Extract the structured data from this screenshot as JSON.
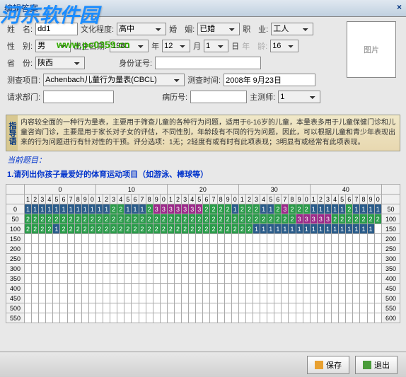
{
  "watermark": "河东软件园",
  "url": "www.pc0359.cn",
  "window": {
    "title": "编辑答案",
    "close": "×"
  },
  "form": {
    "name_lbl": "姓　名:",
    "name": "dd1",
    "edu_lbl": "文化程度:",
    "edu": "高中",
    "marry_lbl": "婚　姻:",
    "marry": "已婚",
    "job_lbl": "职　业:",
    "job": "工人",
    "sex_lbl": "性　别:",
    "sex": "男",
    "birth_lbl": "出生日期:",
    "birth_y": "1980",
    "y": "年",
    "birth_m": "12",
    "m": "月",
    "birth_d": "1",
    "d": "日",
    "age_lbl": "年　龄:",
    "age": "16",
    "prov_lbl": "省　份:",
    "prov": "陕西",
    "id_lbl": "身份证号:",
    "proj_lbl": "测查项目:",
    "proj": "Achenbach儿童行为量表(CBCL)",
    "time_lbl": "测查时间:",
    "time": "2008年 9月23日",
    "dept_lbl": "请求部门:",
    "case_lbl": "病历号:",
    "doc_lbl": "主测师:",
    "doc": "1",
    "imgbox": "图片"
  },
  "guide": {
    "tab": "指导语",
    "text": "内容较全面的一种行为量表，主要用于筛查儿童的各种行为问题，适用于6-16岁的儿童，本量表多用于儿童保健门诊和儿童咨询门诊，主要是用于家长对子女的评估，不同性别，年龄段有不同的行为问题，因此，可以根据儿童和青少年表现出来的行为问题进行有针对性的干预。评分选项：1无；2轻度有或有时有此项表现；3明显有或经常有此项表现。"
  },
  "current": "当前题目：",
  "question": "1.请列出你孩子最爱好的体育运动项目（如游泳、棒球等）",
  "grid": {
    "col_groups": [
      "0",
      "10",
      "20",
      "30",
      "40"
    ],
    "sub": [
      "1",
      "2",
      "3",
      "4",
      "5",
      "6",
      "7",
      "8",
      "9",
      "0"
    ],
    "row_labels": [
      "0",
      "50",
      "100",
      "150",
      "200",
      "250",
      "300",
      "350",
      "400",
      "450",
      "500",
      "550"
    ],
    "row_labels_r": [
      "50",
      "100",
      "150",
      "200",
      "250",
      "300",
      "350",
      "400",
      "450",
      "500",
      "550",
      "600"
    ],
    "data": [
      [
        1,
        1,
        1,
        1,
        1,
        1,
        1,
        1,
        1,
        1,
        1,
        1,
        2,
        2,
        1,
        1,
        1,
        2,
        3,
        3,
        3,
        3,
        3,
        3,
        3,
        2,
        2,
        2,
        2,
        1,
        2,
        2,
        2,
        1,
        1,
        2,
        3,
        2,
        2,
        2,
        1,
        1,
        1,
        1,
        1,
        2,
        1,
        1,
        1,
        1
      ],
      [
        2,
        2,
        2,
        2,
        2,
        2,
        2,
        2,
        2,
        2,
        2,
        2,
        2,
        2,
        2,
        2,
        2,
        2,
        2,
        2,
        2,
        2,
        2,
        2,
        2,
        2,
        2,
        2,
        2,
        2,
        2,
        2,
        2,
        2,
        2,
        2,
        2,
        2,
        3,
        3,
        3,
        3,
        3,
        2,
        2,
        2,
        2,
        2,
        2,
        2
      ],
      [
        2,
        2,
        2,
        2,
        1,
        2,
        2,
        2,
        2,
        2,
        2,
        2,
        2,
        2,
        2,
        2,
        2,
        2,
        2,
        2,
        2,
        2,
        2,
        2,
        2,
        2,
        2,
        2,
        2,
        2,
        2,
        2,
        1,
        1,
        1,
        1,
        1,
        1,
        1,
        1,
        1,
        1,
        1,
        1,
        1,
        1,
        1,
        1,
        1,
        null
      ]
    ]
  },
  "footer": {
    "save": "保存",
    "exit": "退出"
  }
}
